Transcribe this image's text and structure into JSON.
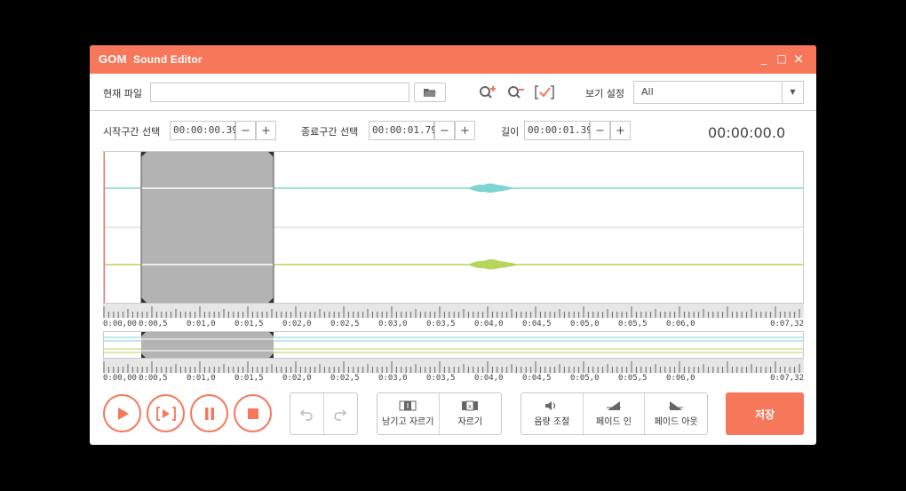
{
  "titlebar": {
    "logo": "GOM",
    "app_name": "Sound Editor",
    "minimize": "_",
    "maximize": "□",
    "close": "×"
  },
  "file": {
    "label": "현재 파일",
    "value": "",
    "open_icon": "folder-open-icon"
  },
  "view": {
    "label": "보기 설정",
    "selected": "All"
  },
  "start": {
    "label": "시작구간 선택",
    "value": "00:00:00.39"
  },
  "end": {
    "label": "종료구간 선택",
    "value": "00:00:01.79"
  },
  "length": {
    "label": "길이",
    "value": "00:00:01.39"
  },
  "stepper": {
    "minus": "−",
    "plus": "+"
  },
  "clock": "00:00:00.0",
  "ruler_labels": [
    "0:00,00",
    "0:00,5",
    "0:01,0",
    "0:01,5",
    "0:02,0",
    "0:02,5",
    "0:03,0",
    "0:03,5",
    "0:04,0",
    "0:04,5",
    "0:05,0",
    "0:05,5",
    "0:06,0",
    "0:07,32"
  ],
  "edit_group": {
    "keep_cut": "남기고 자르기",
    "cut": "자르기"
  },
  "effect_group": {
    "volume": "음량 조절",
    "fade_in": "페이드 인",
    "fade_out": "페이드 아웃"
  },
  "save": "저장",
  "colors": {
    "accent": "#f7775a",
    "channel1": "#7fd3d0",
    "channel2": "#b5d65a",
    "selection": "#b3b3b3"
  }
}
